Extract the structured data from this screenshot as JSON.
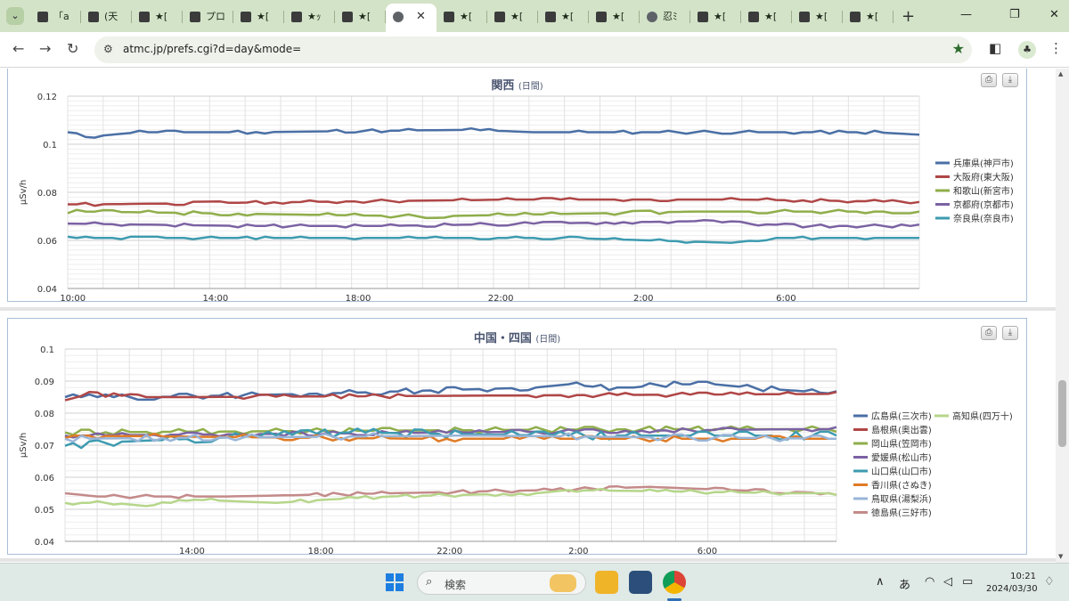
{
  "browser": {
    "tabs": [
      {
        "title": "「a",
        "icon": "site-favicon"
      },
      {
        "title": "(天",
        "icon": "site-favicon"
      },
      {
        "title": "★[",
        "icon": "site-favicon"
      },
      {
        "title": "プロ",
        "icon": "site-favicon"
      },
      {
        "title": "★[",
        "icon": "site-favicon"
      },
      {
        "title": "★ｯ",
        "icon": "site-favicon"
      },
      {
        "title": "★[",
        "icon": "site-favicon"
      },
      {
        "title": "",
        "icon": "globe-icon",
        "active": true
      },
      {
        "title": "★[",
        "icon": "site-favicon"
      },
      {
        "title": "★[",
        "icon": "site-favicon"
      },
      {
        "title": "★[",
        "icon": "site-favicon"
      },
      {
        "title": "★[",
        "icon": "site-favicon"
      },
      {
        "title": "忍ﾐ",
        "icon": "globe-icon"
      },
      {
        "title": "★[",
        "icon": "site-favicon"
      },
      {
        "title": "★[",
        "icon": "site-favicon"
      },
      {
        "title": "★[",
        "icon": "site-favicon"
      },
      {
        "title": "★[",
        "icon": "site-favicon"
      }
    ],
    "active_close": "✕",
    "new_tab": "+",
    "url": "atmc.jp/prefs.cgi?d=day&mode="
  },
  "chart_data": [
    {
      "type": "line",
      "title": "関西",
      "subtitle": "(日間)",
      "ylabel": "μSv/h",
      "ylim": [
        0.04,
        0.12
      ],
      "yticks": [
        "0.04",
        "0.06",
        "0.08",
        "0.1",
        "0.12"
      ],
      "x_tick_labels": [
        "10:00",
        "14:00",
        "18:00",
        "22:00",
        "2:00",
        "6:00"
      ],
      "x_count": 96,
      "legend_position": "right",
      "series": [
        {
          "name": "兵庫県(神戸市)",
          "color": "#4a6fa5",
          "base": 0.104,
          "noise": 0.0006,
          "bumps": [
            [
              0,
              0.105
            ],
            [
              1,
              0.104
            ],
            [
              2,
              0.103
            ],
            [
              8,
              0.105
            ],
            [
              12,
              0.105
            ],
            [
              13,
              0.105
            ],
            [
              17,
              0.105
            ],
            [
              20,
              0.105
            ],
            [
              45,
              0.106
            ],
            [
              52,
              0.105
            ],
            [
              62,
              0.105
            ],
            [
              71,
              0.105
            ],
            [
              79,
              0.105
            ],
            [
              83,
              0.105
            ],
            [
              90,
              0.105
            ],
            [
              95,
              0.104
            ]
          ]
        },
        {
          "name": "大阪府(東大阪)",
          "color": "#b04646",
          "base": 0.076,
          "noise": 0.0006,
          "bumps": [
            [
              0,
              0.075
            ],
            [
              3,
              0.075
            ],
            [
              50,
              0.077
            ],
            [
              53,
              0.077
            ],
            [
              75,
              0.077
            ],
            [
              95,
              0.076
            ]
          ]
        },
        {
          "name": "和歌山(新宮市)",
          "color": "#8fae4a",
          "base": 0.071,
          "noise": 0.0007,
          "bumps": [
            [
              0,
              0.072
            ],
            [
              2,
              0.072
            ],
            [
              40,
              0.07
            ],
            [
              70,
              0.072
            ],
            [
              74,
              0.072
            ],
            [
              85,
              0.072
            ],
            [
              88,
              0.072
            ]
          ]
        },
        {
          "name": "京都府(京都市)",
          "color": "#7b62a3",
          "base": 0.067,
          "noise": 0.0006,
          "bumps": [
            [
              0,
              0.067
            ],
            [
              20,
              0.066
            ],
            [
              35,
              0.066
            ],
            [
              70,
              0.068
            ],
            [
              82,
              0.066
            ]
          ]
        },
        {
          "name": "奈良県(奈良市)",
          "color": "#3d9bb0",
          "base": 0.06,
          "noise": 0.0005,
          "bumps": [
            [
              0,
              0.061
            ],
            [
              1,
              0.061
            ],
            [
              14,
              0.061
            ],
            [
              22,
              0.061
            ],
            [
              56,
              0.061
            ],
            [
              74,
              0.059
            ],
            [
              79,
              0.061
            ]
          ]
        }
      ]
    },
    {
      "type": "line",
      "title": "中国・四国",
      "subtitle": "(日間)",
      "ylabel": "μSv/h",
      "ylim": [
        0.04,
        0.1
      ],
      "yticks": [
        "0.04",
        "0.05",
        "0.06",
        "0.07",
        "0.08",
        "0.09",
        "0.1"
      ],
      "x_tick_labels": [
        "14:00",
        "18:00",
        "22:00",
        "2:00",
        "6:00"
      ],
      "x_count": 96,
      "legend_position": "right",
      "series": [
        {
          "name": "広島県(三次市)",
          "color": "#4a6fa5",
          "base": 0.086,
          "noise": 0.0008,
          "bumps": [
            [
              0,
              0.085
            ],
            [
              10,
              0.085
            ],
            [
              30,
              0.086
            ],
            [
              58,
              0.088
            ],
            [
              62,
              0.089
            ],
            [
              66,
              0.088
            ],
            [
              70,
              0.088
            ],
            [
              74,
              0.089
            ],
            [
              80,
              0.089
            ],
            [
              84,
              0.088
            ],
            [
              90,
              0.087
            ],
            [
              95,
              0.086
            ]
          ]
        },
        {
          "name": "島根県(奥出雲)",
          "color": "#b04646",
          "base": 0.086,
          "noise": 0.0006,
          "bumps": [
            [
              0,
              0.084
            ],
            [
              3,
              0.086
            ],
            [
              10,
              0.085
            ],
            [
              15,
              0.085
            ],
            [
              95,
              0.086
            ]
          ]
        },
        {
          "name": "岡山県(笠岡市)",
          "color": "#8fae4a",
          "base": 0.074,
          "noise": 0.0008,
          "bumps": [
            [
              0,
              0.074
            ],
            [
              72,
              0.075
            ],
            [
              80,
              0.075
            ]
          ]
        },
        {
          "name": "愛媛県(松山市)",
          "color": "#7b62a3",
          "base": 0.074,
          "noise": 0.0006,
          "bumps": [
            [
              0,
              0.073
            ],
            [
              50,
              0.074
            ],
            [
              90,
              0.075
            ]
          ]
        },
        {
          "name": "山口県(山口市)",
          "color": "#3d9bb0",
          "base": 0.072,
          "noise": 0.0012,
          "bumps": [
            [
              0,
              0.071
            ],
            [
              3,
              0.07
            ],
            [
              6,
              0.071
            ],
            [
              35,
              0.074
            ],
            [
              60,
              0.073
            ]
          ]
        },
        {
          "name": "香川県(さぬき)",
          "color": "#e07b26",
          "base": 0.073,
          "noise": 0.0008,
          "bumps": [
            [
              0,
              0.073
            ],
            [
              45,
              0.072
            ],
            [
              90,
              0.072
            ]
          ]
        },
        {
          "name": "鳥取県(湯梨浜)",
          "color": "#99b5d8",
          "base": 0.072,
          "noise": 0.0009,
          "bumps": [
            [
              0,
              0.072
            ],
            [
              50,
              0.073
            ],
            [
              95,
              0.072
            ]
          ]
        },
        {
          "name": "徳島県(三好市)",
          "color": "#c48a8a",
          "base": 0.055,
          "noise": 0.0005,
          "bumps": [
            [
              0,
              0.055
            ],
            [
              4,
              0.054
            ],
            [
              20,
              0.054
            ],
            [
              40,
              0.055
            ],
            [
              60,
              0.056
            ],
            [
              72,
              0.057
            ],
            [
              82,
              0.056
            ],
            [
              95,
              0.055
            ]
          ]
        },
        {
          "name": "高知県(四万十)",
          "color": "#b6d68a",
          "base": 0.054,
          "noise": 0.0005,
          "bumps": [
            [
              0,
              0.052
            ],
            [
              6,
              0.052
            ],
            [
              10,
              0.051
            ],
            [
              16,
              0.053
            ],
            [
              26,
              0.052
            ],
            [
              32,
              0.053
            ],
            [
              40,
              0.054
            ],
            [
              58,
              0.055
            ],
            [
              62,
              0.056
            ],
            [
              90,
              0.055
            ]
          ]
        }
      ]
    }
  ],
  "taskbar": {
    "search_label": "検索",
    "ime": "あ",
    "time": "10:21",
    "date": "2024/03/30"
  }
}
